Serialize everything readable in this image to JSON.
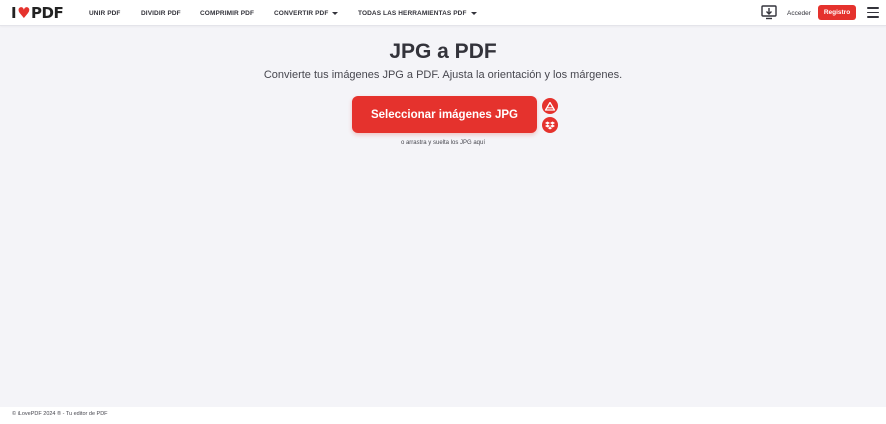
{
  "brand": {
    "logo_prefix": "I",
    "logo_heart": "♥",
    "logo_suffix": "PDF",
    "accent_color": "#e5322d"
  },
  "nav": {
    "items": [
      {
        "label": "UNIR PDF"
      },
      {
        "label": "DIVIDIR PDF"
      },
      {
        "label": "COMPRIMIR PDF"
      },
      {
        "label": "CONVERTIR PDF",
        "has_dropdown": true
      },
      {
        "label": "TODAS LAS HERRAMIENTAS PDF",
        "has_dropdown": true
      }
    ],
    "desktop_icon": "desktop-download-icon",
    "login_label": "Acceder",
    "signup_label": "Registro",
    "menu_icon": "hamburger-menu-icon"
  },
  "main": {
    "title": "JPG a PDF",
    "subtitle": "Convierte tus imágenes JPG a PDF. Ajusta la orientación y los márgenes.",
    "select_button_label": "Seleccionar imágenes JPG",
    "cloud_buttons": [
      {
        "icon": "google-drive-icon"
      },
      {
        "icon": "dropbox-icon"
      }
    ],
    "drop_hint": "o arrastra y suelta los JPG aquí"
  },
  "footer": {
    "text": "© iLovePDF 2024 ® - Tu editor de PDF"
  }
}
